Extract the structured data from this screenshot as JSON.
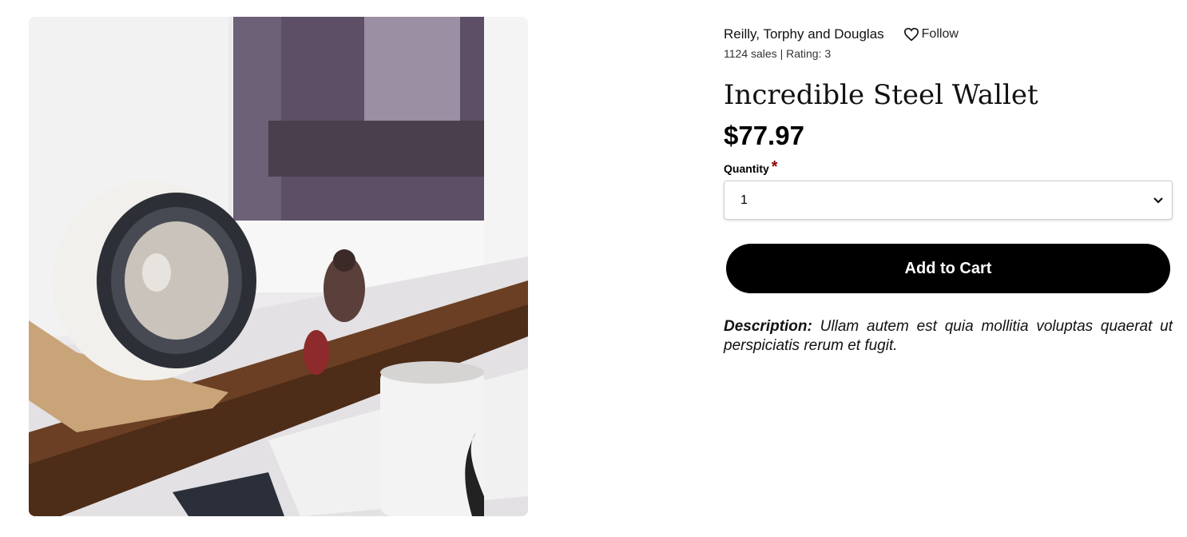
{
  "product": {
    "image_alt": "Desk with speaker, monitor, figurines and mug",
    "seller": {
      "name": "Reilly, Torphy and Douglas",
      "follow_label": "Follow",
      "meta": "1124 sales | Rating: 3"
    },
    "title": "Incredible Steel Wallet",
    "price": "$77.97",
    "quantity": {
      "label": "Quantity",
      "required_mark": "*",
      "selected": "1"
    },
    "add_to_cart_label": "Add to Cart",
    "description": {
      "label": "Description:",
      "text": "Ullam autem est quia mollitia voluptas quaerat ut perspiciatis rerum et fugit."
    }
  },
  "icons": {
    "follow": "heart-icon",
    "select": "chevron-down-icon"
  },
  "colors": {
    "button_bg": "#000000",
    "button_text": "#ffffff",
    "required": "#8b0000"
  }
}
